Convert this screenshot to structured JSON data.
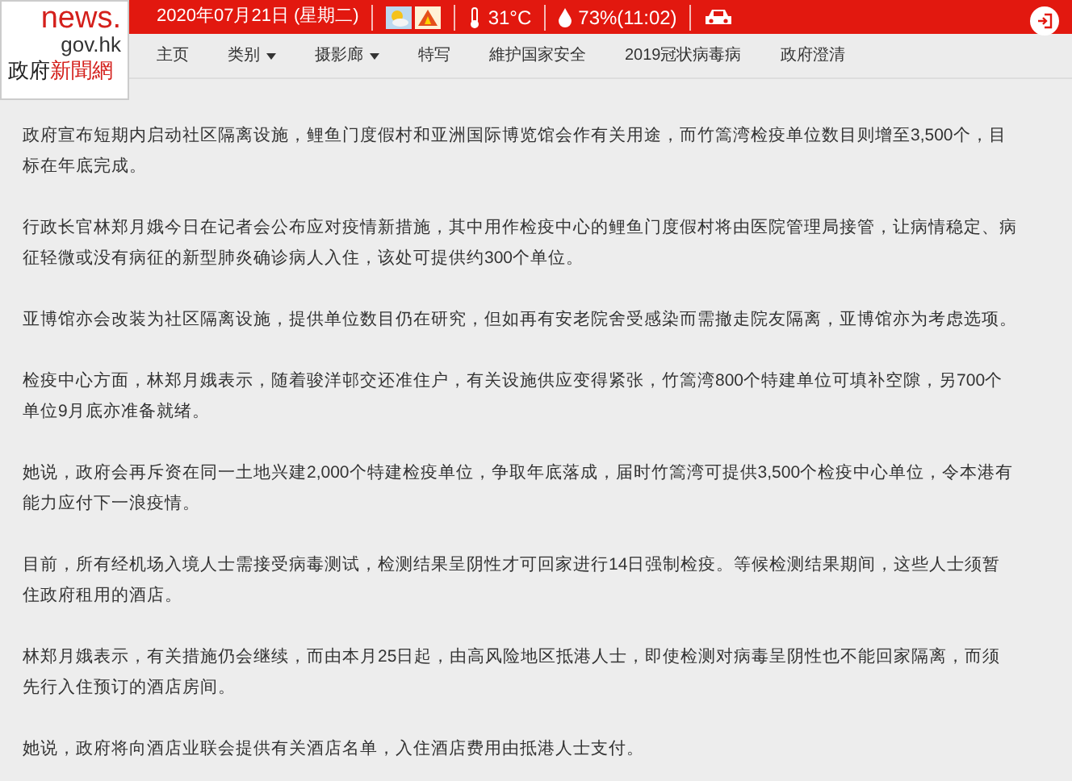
{
  "logo": {
    "brand": "news.",
    "domain": "gov.hk",
    "tagline": [
      {
        "text": "政府",
        "kind": "plain"
      },
      {
        "text": "新聞網",
        "kind": "accent"
      }
    ]
  },
  "topbar": {
    "date": "2020年07月21日 (星期二)",
    "temperature": "31°C",
    "humidity": "73%(11:02)"
  },
  "nav": [
    {
      "label": "主页",
      "dropdown": false
    },
    {
      "label": "类别",
      "dropdown": true
    },
    {
      "label": "摄影廊",
      "dropdown": true
    },
    {
      "label": "特写",
      "dropdown": false
    },
    {
      "label": "維护国家安全",
      "dropdown": false
    },
    {
      "label": "2019冠状病毒病",
      "dropdown": false
    },
    {
      "label": "政府澄清",
      "dropdown": false
    }
  ],
  "paragraphs": [
    "政府宣布短期内启动社区隔离设施，鲤鱼门度假村和亚洲国际博览馆会作有关用途，而竹篙湾检疫单位数目则增至3,500个，目标在年底完成。",
    "行政长官林郑月娥今日在记者会公布应对疫情新措施，其中用作检疫中心的鲤鱼门度假村将由医院管理局接管，让病情稳定、病征轻微或没有病征的新型肺炎确诊病人入住，该处可提供约300个单位。",
    "亚博馆亦会改装为社区隔离设施，提供单位数目仍在研究，但如再有安老院舍受感染而需撤走院友隔离，亚博馆亦为考虑选项。",
    "检疫中心方面，林郑月娥表示，随着骏洋邨交还准住户，有关设施供应变得紧张，竹篙湾800个特建单位可填补空隙，另700个单位9月底亦准备就绪。",
    "她说，政府会再斥资在同一土地兴建2,000个特建检疫单位，争取年底落成，届时竹篙湾可提供3,500个检疫中心单位，令本港有能力应付下一浪疫情。",
    "目前，所有经机场入境人士需接受病毒测试，检测结果呈阴性才可回家进行14日强制检疫。等候检测结果期间，这些人士须暂住政府租用的酒店。",
    "林郑月娥表示，有关措施仍会继续，而由本月25日起，由高风险地区抵港人士，即使检测对病毒呈阴性也不能回家隔离，而须先行入住预订的酒店房间。",
    "她说，政府将向酒店业联会提供有关酒店名单，入住酒店费用由抵港人士支付。"
  ]
}
